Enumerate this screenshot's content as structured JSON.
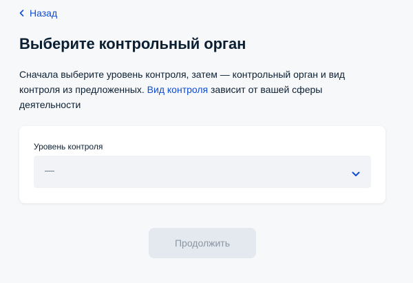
{
  "nav": {
    "back_label": "Назад"
  },
  "page": {
    "title": "Выберите контрольный орган",
    "intro_before_link": "Сначала выберите уровень контроля, затем — контрольный орган и вид контроля из предложенных. ",
    "intro_link": "Вид контроля",
    "intro_after_link": " зависит от вашей сферы деятельности"
  },
  "form": {
    "level_label": "Уровень контроля",
    "level_value": "—",
    "level_icon": "chevron-down-icon"
  },
  "actions": {
    "continue_label": "Продолжить"
  },
  "colors": {
    "accent": "#0d4cd3",
    "text": "#0b1f33",
    "background": "#f7f8fa",
    "field_background": "#f1f3f6",
    "disabled_button": "#e4e8ef",
    "disabled_text": "#8b96a3"
  }
}
